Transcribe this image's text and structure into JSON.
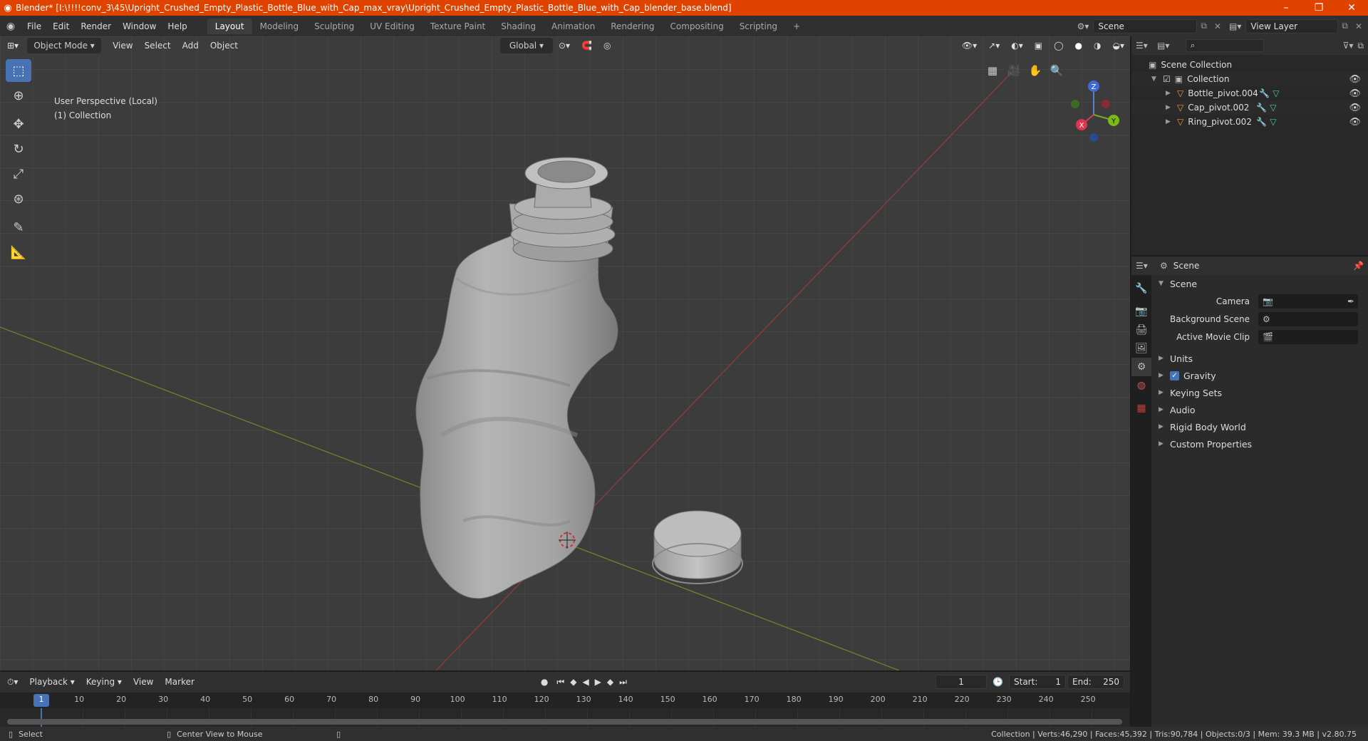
{
  "window": {
    "title": "Blender* [I:\\!!!!conv_3\\45\\Upright_Crushed_Empty_Plastic_Bottle_Blue_with_Cap_max_vray\\Upright_Crushed_Empty_Plastic_Bottle_Blue_with_Cap_blender_base.blend]"
  },
  "menu": [
    "File",
    "Edit",
    "Render",
    "Window",
    "Help"
  ],
  "workspaces": [
    "Layout",
    "Modeling",
    "Sculpting",
    "UV Editing",
    "Texture Paint",
    "Shading",
    "Animation",
    "Rendering",
    "Compositing",
    "Scripting"
  ],
  "active_workspace": "Layout",
  "scene_field": "Scene",
  "view_layer_field": "View Layer",
  "viewport": {
    "mode": "Object Mode",
    "menus": [
      "View",
      "Select",
      "Add",
      "Object"
    ],
    "transform_orientation": "Global",
    "perspective_label": "User Perspective (Local)",
    "collection_label": "(1) Collection",
    "gizmo": {
      "x": "X",
      "y": "Y",
      "z": "Z"
    }
  },
  "outliner": {
    "root": "Scene Collection",
    "collection": "Collection",
    "objects": [
      "Bottle_pivot.004",
      "Cap_pivot.002",
      "Ring_pivot.002"
    ]
  },
  "properties": {
    "context": "Scene",
    "panel_title": "Scene",
    "rows": [
      {
        "label": "Camera",
        "value": ""
      },
      {
        "label": "Background Scene",
        "value": ""
      },
      {
        "label": "Active Movie Clip",
        "value": ""
      }
    ],
    "subpanels": [
      "Units",
      "Gravity",
      "Keying Sets",
      "Audio",
      "Rigid Body World",
      "Custom Properties"
    ],
    "gravity_checked": true
  },
  "timeline": {
    "menus": [
      "Playback",
      "Keying",
      "View",
      "Marker"
    ],
    "current_frame": "1",
    "start_label": "Start:",
    "start": "1",
    "end_label": "End:",
    "end": "250",
    "ticks": [
      "1",
      "10",
      "20",
      "30",
      "40",
      "50",
      "60",
      "70",
      "80",
      "90",
      "100",
      "110",
      "120",
      "130",
      "140",
      "150",
      "160",
      "170",
      "180",
      "190",
      "200",
      "210",
      "220",
      "230",
      "240",
      "250"
    ]
  },
  "statusbar": {
    "left_action": "Select",
    "middle_action": "Center View to Mouse",
    "stats": "Collection | Verts:46,290 | Faces:45,392 | Tris:90,784 | Objects:0/3 | Mem: 39.3 MB | v2.80.75"
  },
  "colors": {
    "accent": "#4772b3",
    "titlebar": "#e04300",
    "viewport": "#3c3c3c"
  }
}
